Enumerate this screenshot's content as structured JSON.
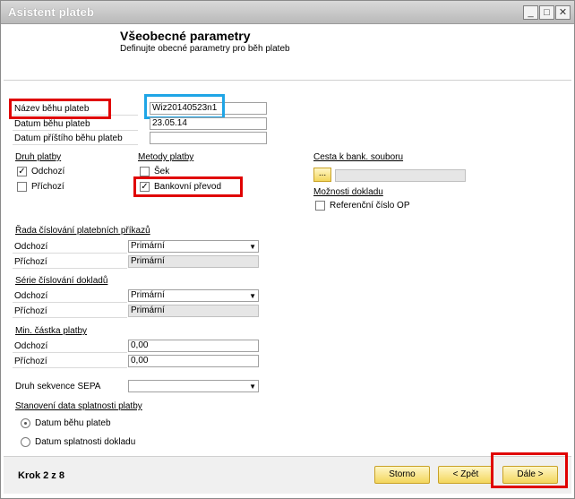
{
  "window": {
    "title": "Asistent plateb",
    "buttons": [
      "_",
      "□",
      "✕"
    ]
  },
  "header": {
    "title": "Všeobecné parametry",
    "subtitle": "Definujte obecné parametry pro běh plateb"
  },
  "run": {
    "name_label": "Název běhu plateb",
    "name_value": "Wiz20140523n1",
    "date_label": "Datum běhu plateb",
    "date_value": "23.05.14",
    "next_date_label": "Datum příštího běhu plateb",
    "next_date_value": ""
  },
  "payment_type": {
    "title": "Druh platby",
    "outgoing": "Odchozí",
    "incoming": "Příchozí",
    "outgoing_checked": true,
    "incoming_checked": false
  },
  "payment_methods": {
    "title": "Metody platby",
    "check": "Šek",
    "transfer": "Bankovní převod",
    "check_checked": false,
    "transfer_checked": true
  },
  "bank_file": {
    "title": "Cesta k bank. souboru",
    "browse_label": "...",
    "path": ""
  },
  "doc_options": {
    "title": "Možnosti dokladu",
    "ref": "Referenční číslo OP",
    "ref_checked": false
  },
  "order_series": {
    "title": "Řada číslování platebních příkazů",
    "outgoing_label": "Odchozí",
    "outgoing_value": "Primární",
    "incoming_label": "Příchozí",
    "incoming_value": "Primární"
  },
  "doc_series": {
    "title": "Série číslování dokladů",
    "outgoing_label": "Odchozí",
    "outgoing_value": "Primární",
    "incoming_label": "Příchozí",
    "incoming_value": "Primární"
  },
  "min_amount": {
    "title": "Min. částka platby",
    "outgoing_label": "Odchozí",
    "outgoing_value": "0,00",
    "incoming_label": "Příchozí",
    "incoming_value": "0,00"
  },
  "sepa": {
    "label": "Druh sekvence SEPA",
    "value": ""
  },
  "due_date": {
    "title": "Stanovení data splatnosti platby",
    "opt1": "Datum běhu plateb",
    "opt2": "Datum splatnosti dokladu",
    "selected": "opt1"
  },
  "footer": {
    "step": "Krok 2 z 8",
    "cancel": "Storno",
    "back": "< Zpět",
    "next": "Dále >"
  },
  "colors": {
    "highlight_red": "#e00000",
    "highlight_blue": "#1fa5e6",
    "button_yellow": "#f3d65c"
  }
}
